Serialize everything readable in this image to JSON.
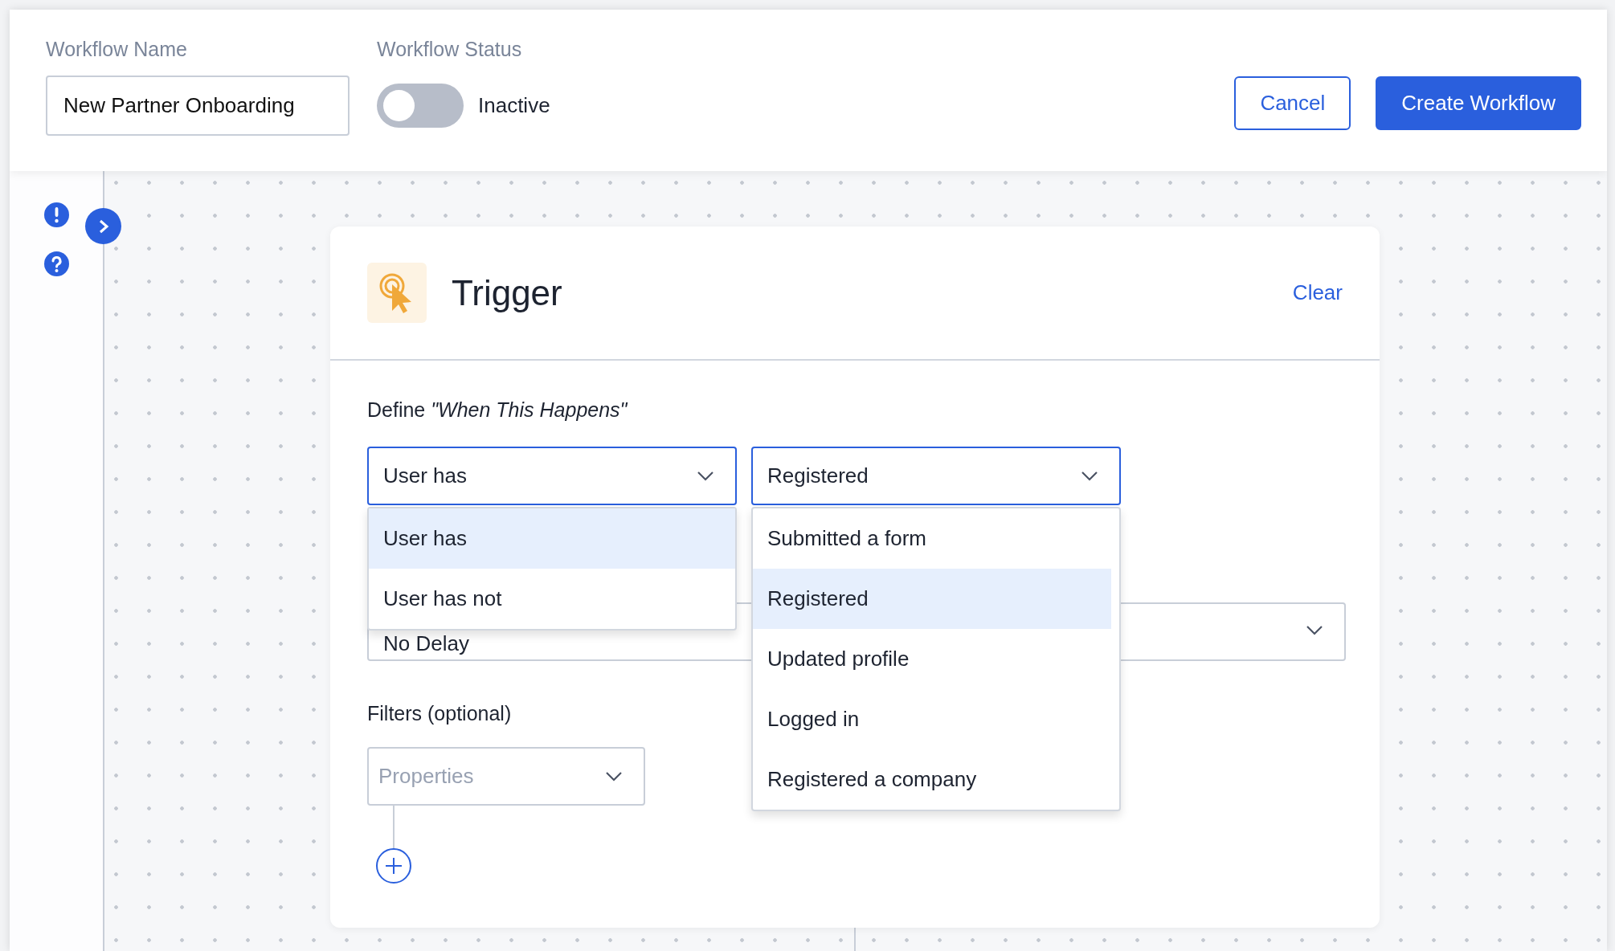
{
  "header": {
    "name_label": "Workflow Name",
    "name_value": "New Partner Onboarding",
    "status_label": "Workflow Status",
    "status": {
      "on": false,
      "label": "Inactive"
    },
    "buttons": [
      {
        "label": "Cancel",
        "kind": "secondary"
      },
      {
        "label": "Create Workflow",
        "kind": "primary"
      }
    ]
  },
  "trigger": {
    "title": "Trigger",
    "clear": "Clear",
    "define_label": "Define *\"When This Happens\"*",
    "condition": {
      "value": "User has",
      "expanded": true,
      "options": [
        {
          "label": "User has",
          "selected": true
        },
        {
          "label": "User has not",
          "selected": false
        }
      ]
    },
    "event": {
      "value": "Registered",
      "expanded": true,
      "options": [
        {
          "label": "Submitted a form",
          "selected": false
        },
        {
          "label": "Registered",
          "selected": true
        },
        {
          "label": "Updated profile",
          "selected": false
        },
        {
          "label": "Logged in",
          "selected": false
        },
        {
          "label": "Registered a company",
          "selected": false
        }
      ]
    },
    "delay": {
      "value": "No Delay"
    },
    "filters_label": "Filters (optional)",
    "filters": {
      "placeholder": "Properties"
    }
  }
}
